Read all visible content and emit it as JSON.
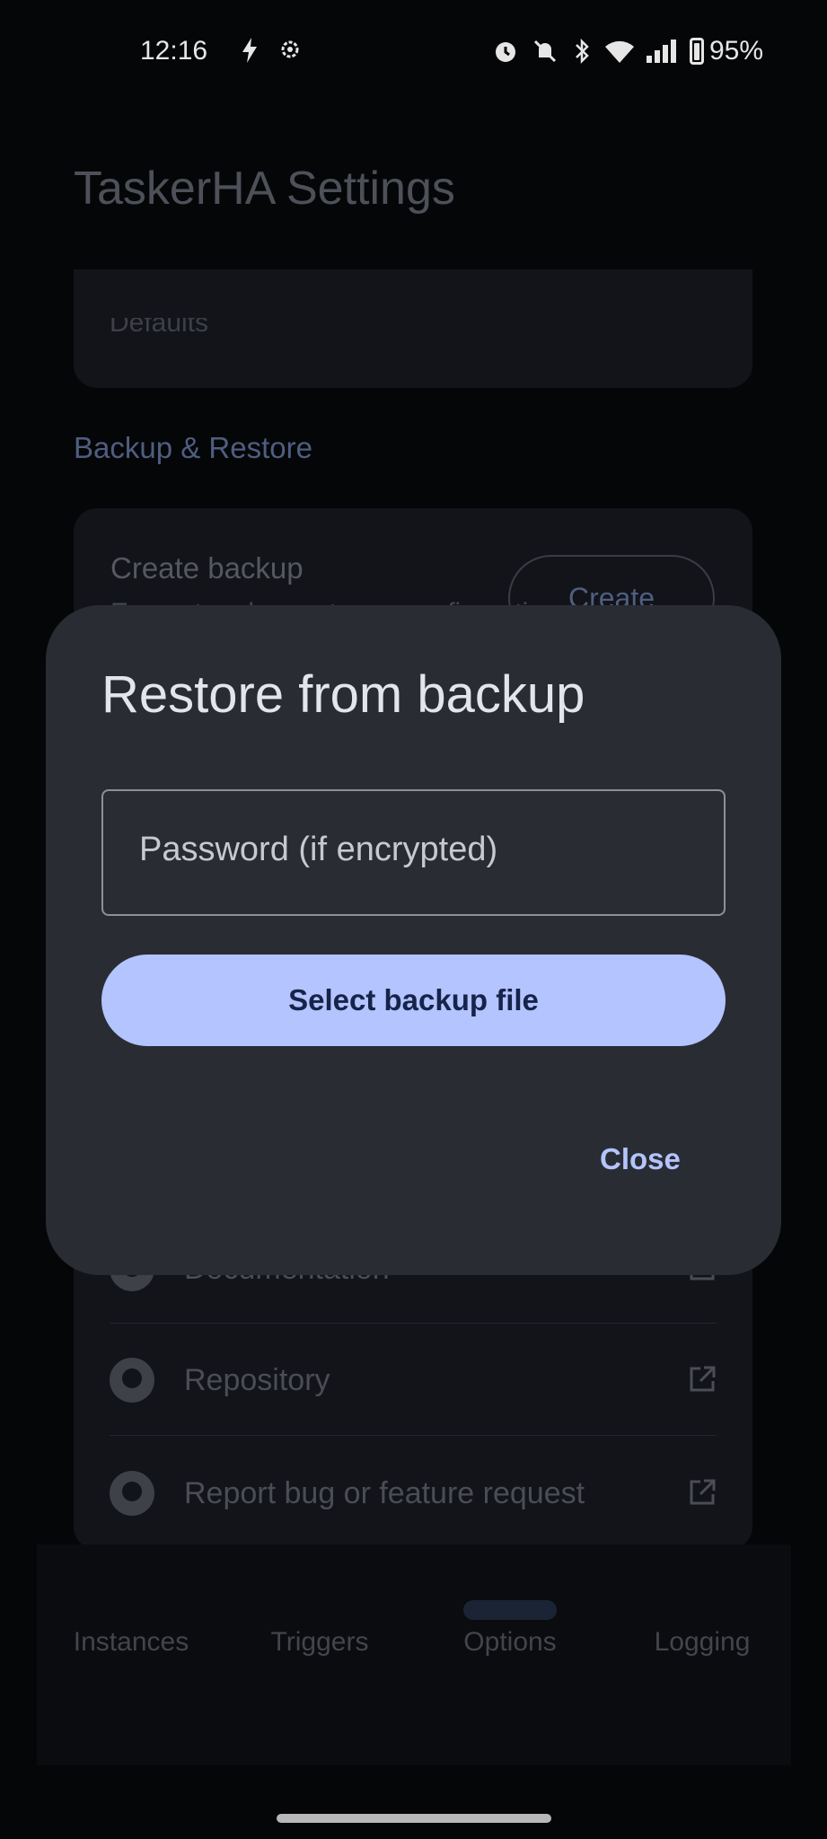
{
  "status_bar": {
    "time": "12:16",
    "battery": "95%",
    "icons": [
      "flash-icon",
      "settings-gear-icon",
      "alarm-icon",
      "notifications-off-icon",
      "bluetooth-icon",
      "wifi-icon",
      "signal-icon",
      "battery-icon"
    ]
  },
  "app": {
    "title": "TaskerHA Settings",
    "clipped_item": "Defaults",
    "section_header": "Backup & Restore",
    "backup": {
      "title": "Create backup",
      "subtitle": "Encrypt and export your configuration",
      "button": "Create"
    },
    "links": [
      {
        "label": "Documentation",
        "icon": "github-icon"
      },
      {
        "label": "Repository",
        "icon": "github-icon"
      },
      {
        "label": "Report bug or feature request",
        "icon": "github-icon"
      }
    ]
  },
  "nav": {
    "items": [
      "Instances",
      "Triggers",
      "Options",
      "Logging"
    ],
    "active": "Options"
  },
  "dialog": {
    "title": "Restore from backup",
    "password_placeholder": "Password (if encrypted)",
    "select_button": "Select backup file",
    "close_button": "Close"
  },
  "colors": {
    "accent": "#b3c4fe",
    "dialog_bg": "#2a2c33",
    "screen_bg": "#050608"
  }
}
